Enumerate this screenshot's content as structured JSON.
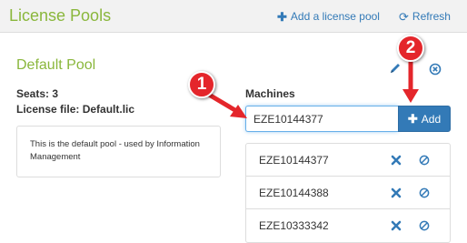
{
  "header": {
    "title": "License Pools",
    "add_pool_label": "Add a license pool",
    "refresh_label": "Refresh"
  },
  "pool": {
    "name": "Default Pool",
    "seats": "Seats: 3",
    "license_file": "License file: Default.lic",
    "description": "This is the default pool - used by Information Management"
  },
  "machines": {
    "label": "Machines",
    "input_value": "EZE10144377",
    "add_label": "Add",
    "items": [
      {
        "name": "EZE10144377"
      },
      {
        "name": "EZE10144388"
      },
      {
        "name": "EZE10333342"
      }
    ]
  },
  "callouts": {
    "one": "1",
    "two": "2"
  },
  "colors": {
    "brand_green": "#8ab73c",
    "link_blue": "#337ab7",
    "callout_red": "#e4262b"
  },
  "icons": [
    "plus-icon",
    "refresh-icon",
    "pencil-icon",
    "remove-circle-icon",
    "delete-x-icon",
    "disable-icon"
  ]
}
